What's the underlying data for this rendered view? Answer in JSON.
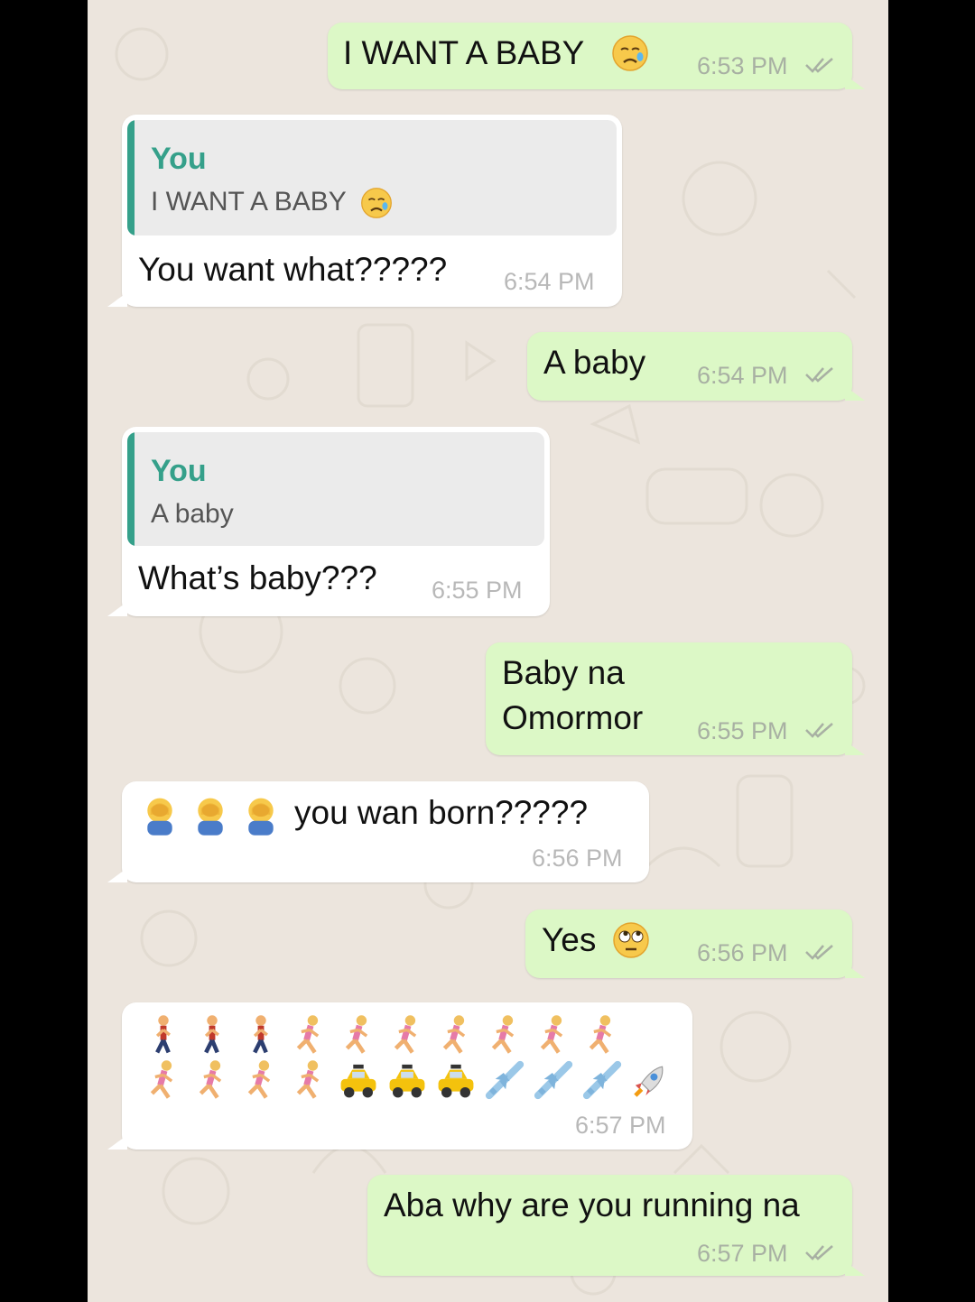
{
  "messages": [
    {
      "text": "I WANT A BABY",
      "emoji": "crying-face",
      "time": "6:53 PM"
    },
    {
      "quote_author": "You",
      "quote_text": "I WANT A BABY",
      "quote_emoji": "crying-face",
      "text": "You want what?????",
      "time": "6:54 PM"
    },
    {
      "text": "A baby",
      "time": "6:54 PM"
    },
    {
      "quote_author": "You",
      "quote_text": "A baby",
      "text": "What’s baby???",
      "time": "6:55 PM"
    },
    {
      "text_line1": "Baby na",
      "text_line2": "Omormor",
      "time": "6:55 PM"
    },
    {
      "emojis": [
        "facepalm",
        "facepalm",
        "facepalm"
      ],
      "text": "you wan born?????",
      "time": "6:56 PM"
    },
    {
      "text": "Yes",
      "emoji": "rolling-eyes-face",
      "time": "6:56 PM"
    },
    {
      "emojis_row1": [
        "walking",
        "walking",
        "walking",
        "running",
        "running",
        "running",
        "running",
        "running",
        "running",
        "running"
      ],
      "emojis_row2": [
        "running",
        "running",
        "running",
        "running",
        "taxi",
        "taxi",
        "taxi",
        "airplane",
        "airplane",
        "airplane",
        "rocket"
      ],
      "time": "6:57 PM"
    },
    {
      "text": "Aba why are you running na",
      "time": "6:57 PM"
    }
  ],
  "colors": {
    "outgoing_bubble": "#dcf8c6",
    "incoming_bubble": "#ffffff",
    "quote_accent": "#35a08a",
    "wallpaper": "#ece5dd",
    "tick_color": "#a8b0a3"
  }
}
